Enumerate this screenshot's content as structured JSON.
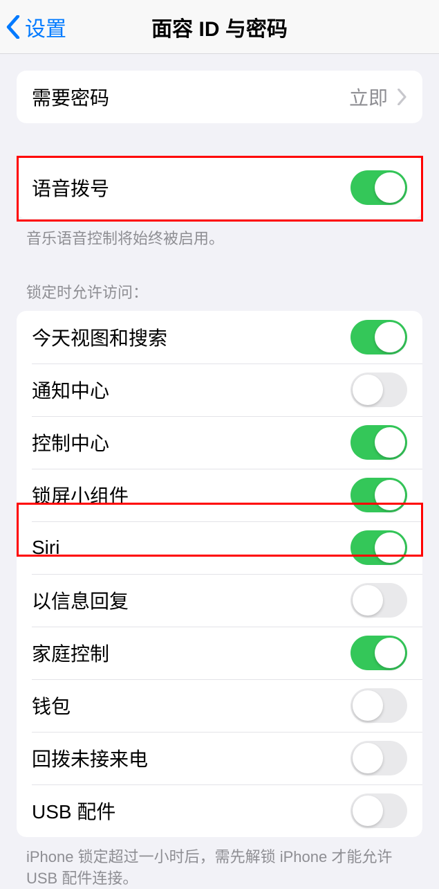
{
  "nav": {
    "back_label": "设置",
    "title": "面容 ID 与密码"
  },
  "require_passcode": {
    "label": "需要密码",
    "value": "立即"
  },
  "voice_dial": {
    "label": "语音拨号",
    "on": true,
    "footer": "音乐语音控制将始终被启用。"
  },
  "allow_access": {
    "header": "锁定时允许访问：",
    "items": [
      {
        "label": "今天视图和搜索",
        "on": true
      },
      {
        "label": "通知中心",
        "on": false
      },
      {
        "label": "控制中心",
        "on": true
      },
      {
        "label": "锁屏小组件",
        "on": true
      },
      {
        "label": "Siri",
        "on": true
      },
      {
        "label": "以信息回复",
        "on": false
      },
      {
        "label": "家庭控制",
        "on": true
      },
      {
        "label": "钱包",
        "on": false
      },
      {
        "label": "回拨未接来电",
        "on": false
      },
      {
        "label": "USB 配件",
        "on": false
      }
    ],
    "footer": "iPhone 锁定超过一小时后，需先解锁 iPhone 才能允许 USB 配件连接。"
  },
  "colors": {
    "toggle_on": "#34c759",
    "toggle_off": "#e9e9eb",
    "link": "#007aff",
    "secondary": "#8e8e93",
    "highlight": "#ff0000"
  }
}
